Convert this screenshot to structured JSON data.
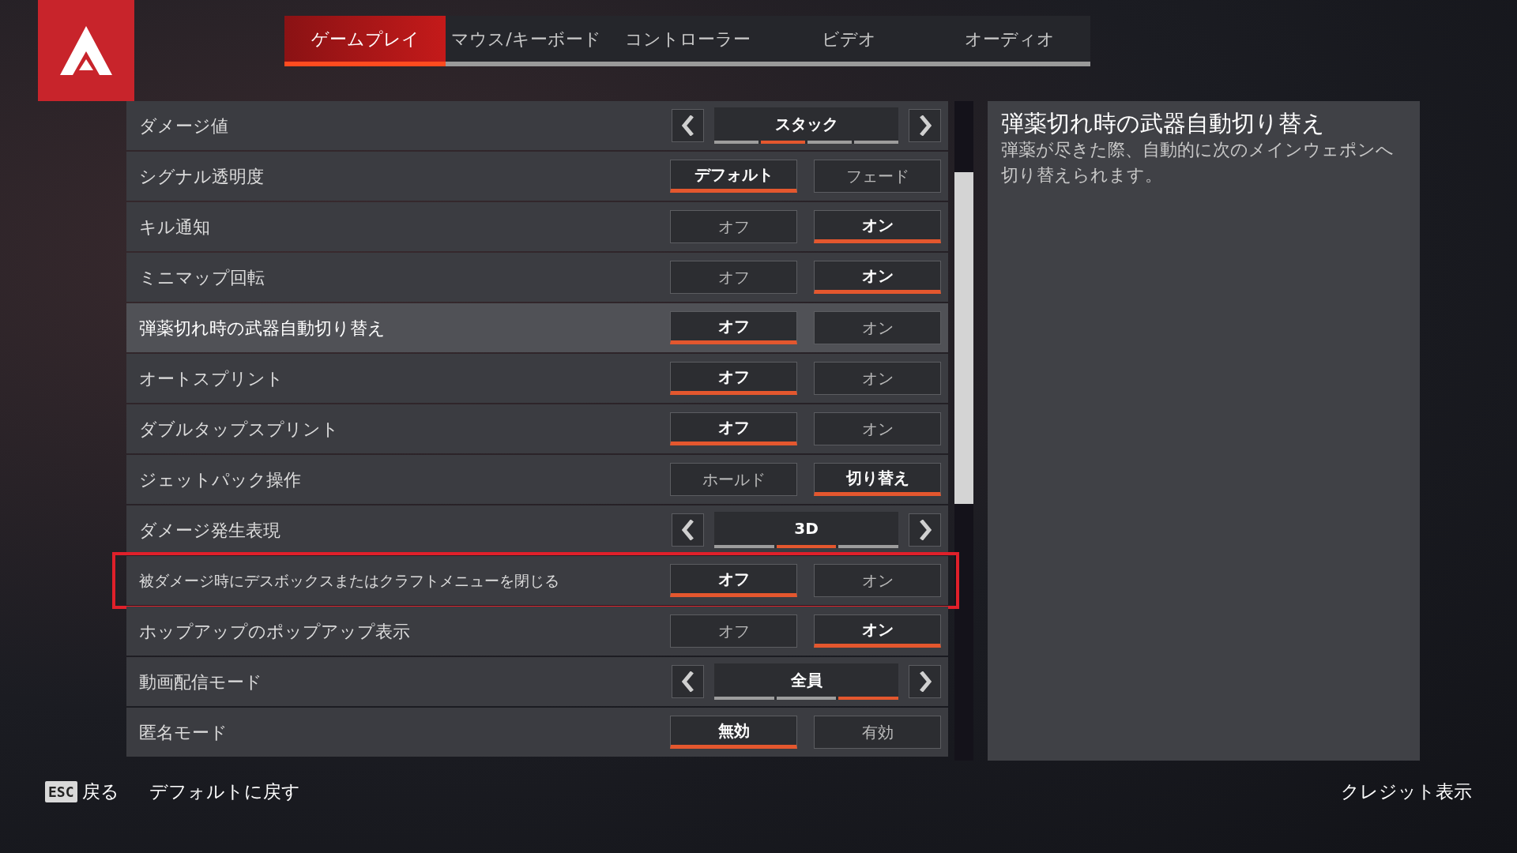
{
  "tabs": [
    {
      "label": "ゲームプレイ",
      "selected": true
    },
    {
      "label": "マウス/キーボード",
      "selected": false
    },
    {
      "label": "コントローラー",
      "selected": false
    },
    {
      "label": "ビデオ",
      "selected": false
    },
    {
      "label": "オーディオ",
      "selected": false
    }
  ],
  "settings": [
    {
      "kind": "cycle",
      "label": "ダメージ値",
      "value": "スタック",
      "hovered": false,
      "outlined": false,
      "segments": [
        {
          "selected": false
        },
        {
          "selected": true
        },
        {
          "selected": false
        },
        {
          "selected": false
        }
      ]
    },
    {
      "kind": "toggle",
      "label": "シグナル透明度",
      "hovered": false,
      "outlined": false,
      "options": [
        {
          "label": "デフォルト",
          "selected": true
        },
        {
          "label": "フェード",
          "selected": false
        }
      ]
    },
    {
      "kind": "toggle",
      "label": "キル通知",
      "hovered": false,
      "outlined": false,
      "options": [
        {
          "label": "オフ",
          "selected": false
        },
        {
          "label": "オン",
          "selected": true
        }
      ]
    },
    {
      "kind": "toggle",
      "label": "ミニマップ回転",
      "hovered": false,
      "outlined": false,
      "options": [
        {
          "label": "オフ",
          "selected": false
        },
        {
          "label": "オン",
          "selected": true
        }
      ]
    },
    {
      "kind": "toggle",
      "label": "弾薬切れ時の武器自動切り替え",
      "hovered": true,
      "outlined": false,
      "options": [
        {
          "label": "オフ",
          "selected": true
        },
        {
          "label": "オン",
          "selected": false
        }
      ]
    },
    {
      "kind": "toggle",
      "label": "オートスプリント",
      "hovered": false,
      "outlined": false,
      "options": [
        {
          "label": "オフ",
          "selected": true
        },
        {
          "label": "オン",
          "selected": false
        }
      ]
    },
    {
      "kind": "toggle",
      "label": "ダブルタップスプリント",
      "hovered": false,
      "outlined": false,
      "options": [
        {
          "label": "オフ",
          "selected": true
        },
        {
          "label": "オン",
          "selected": false
        }
      ]
    },
    {
      "kind": "toggle",
      "label": "ジェットパック操作",
      "hovered": false,
      "outlined": false,
      "options": [
        {
          "label": "ホールド",
          "selected": false
        },
        {
          "label": "切り替え",
          "selected": true
        }
      ]
    },
    {
      "kind": "cycle",
      "label": "ダメージ発生表現",
      "value": "3D",
      "hovered": false,
      "outlined": false,
      "segments": [
        {
          "selected": false
        },
        {
          "selected": true
        },
        {
          "selected": false
        }
      ]
    },
    {
      "kind": "toggle",
      "label": "被ダメージ時にデスボックスまたはクラフトメニューを閉じる",
      "hovered": false,
      "outlined": true,
      "options": [
        {
          "label": "オフ",
          "selected": true
        },
        {
          "label": "オン",
          "selected": false
        }
      ]
    },
    {
      "kind": "toggle",
      "label": "ホップアップのポップアップ表示",
      "hovered": false,
      "outlined": false,
      "options": [
        {
          "label": "オフ",
          "selected": false
        },
        {
          "label": "オン",
          "selected": true
        }
      ]
    },
    {
      "kind": "cycle",
      "label": "動画配信モード",
      "value": "全員",
      "hovered": false,
      "outlined": false,
      "segments": [
        {
          "selected": false
        },
        {
          "selected": false
        },
        {
          "selected": true
        }
      ]
    },
    {
      "kind": "toggle",
      "label": "匿名モード",
      "hovered": false,
      "outlined": false,
      "options": [
        {
          "label": "無効",
          "selected": true
        },
        {
          "label": "有効",
          "selected": false
        }
      ]
    }
  ],
  "description": {
    "title": "弾薬切れ時の武器自動切り替え",
    "text": "弾薬が尽きた際、自動的に次のメインウェポンへ切り替えられます。"
  },
  "footer": {
    "esc_key": "ESC",
    "back": "戻る",
    "reset": "デフォルトに戻す",
    "credits": "クレジット表示"
  }
}
